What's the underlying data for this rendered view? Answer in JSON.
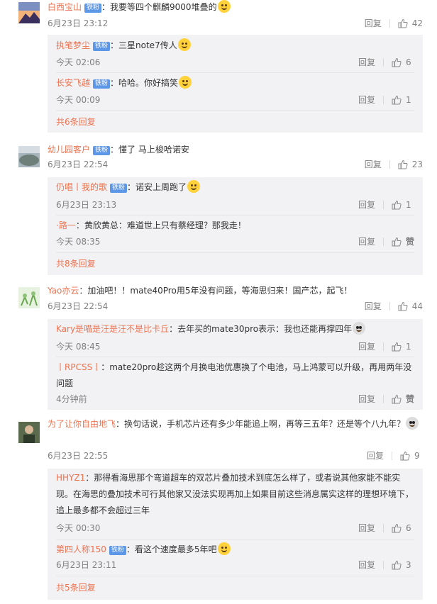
{
  "labels": {
    "reply": "回复",
    "badge": "铁粉"
  },
  "comments": [
    {
      "user": "白西宝山",
      "badge": true,
      "text": "：我要等四个麒麟9000堆叠的",
      "time": "6月23日 23:12",
      "likes": "42",
      "replies": [],
      "more": ""
    },
    {
      "user": "",
      "badge": false,
      "text": "",
      "time": "",
      "likes": "",
      "replies": [
        {
          "user": "执笔梦尘",
          "badge": true,
          "text": "：三星note7传人",
          "time": "今天 02:06",
          "likes": "6"
        },
        {
          "user": "长安飞越",
          "badge": true,
          "text": "：哈哈。你好搞笑",
          "time": "今天 00:09",
          "likes": "1"
        }
      ],
      "more": "共6条回复"
    },
    {
      "user": "幼儿园客户",
      "badge": true,
      "text": "：懂了 马上梭哈诺安",
      "time": "6月23日 22:54",
      "likes": "23",
      "replies": [
        {
          "user": "仍唱丨我的歌",
          "badge": true,
          "text": "：诺安上周跑了",
          "time": "6月23日 23:13",
          "likes": "1"
        },
        {
          "user": "·路一",
          "badge": false,
          "text": "：黄欣黄总：难道世上只有蔡经理？那我走！",
          "time": "今天 08:35",
          "likes": "赞"
        }
      ],
      "more": "共8条回复"
    },
    {
      "user": "Yao亦云",
      "badge": false,
      "text": "：加油吧！！mate40Pro用5年没有问题，等海思归来！国产芯，起飞！",
      "time": "6月23日 22:54",
      "likes": "44",
      "replies": [
        {
          "user": "Kary是喵是汪是汪不是比卡丘",
          "badge": false,
          "text": "：去年买的mate30pro表示：我也还能再撑四年",
          "time": "今天 08:45",
          "likes": "1"
        },
        {
          "user": "丨RPCSS丨",
          "badge": false,
          "text": "：mate20pro趁这两个月换电池优惠换了个电池，马上鸿蒙可以升级，再用两年没问题",
          "time": "4分钟前",
          "likes": "赞"
        }
      ],
      "more": ""
    },
    {
      "user": "为了让你自由地飞",
      "badge": false,
      "text": "：换句话说，手机芯片还有多少年能追上啊，再等三五年？还是等个八九年？",
      "time": "6月23日 22:55",
      "likes": "9",
      "replies": [
        {
          "user": "HHYZ1",
          "badge": false,
          "text": "：那得看海思那个弯道超车的双芯片叠加技术到底怎么样了，或者说其他家能不能实现。在海思的叠加技术可行其他家又没法实现再加上如果目前这些消息属实这样的理想环境下，追上最多都不会超过三年",
          "time": "今天 00:30",
          "likes": "6"
        },
        {
          "user": "第四人称150",
          "badge": true,
          "text": "：看这个速度最多5年吧",
          "time": "6月23日 23:11",
          "likes": "3"
        }
      ],
      "more": "共5条回复"
    }
  ]
}
